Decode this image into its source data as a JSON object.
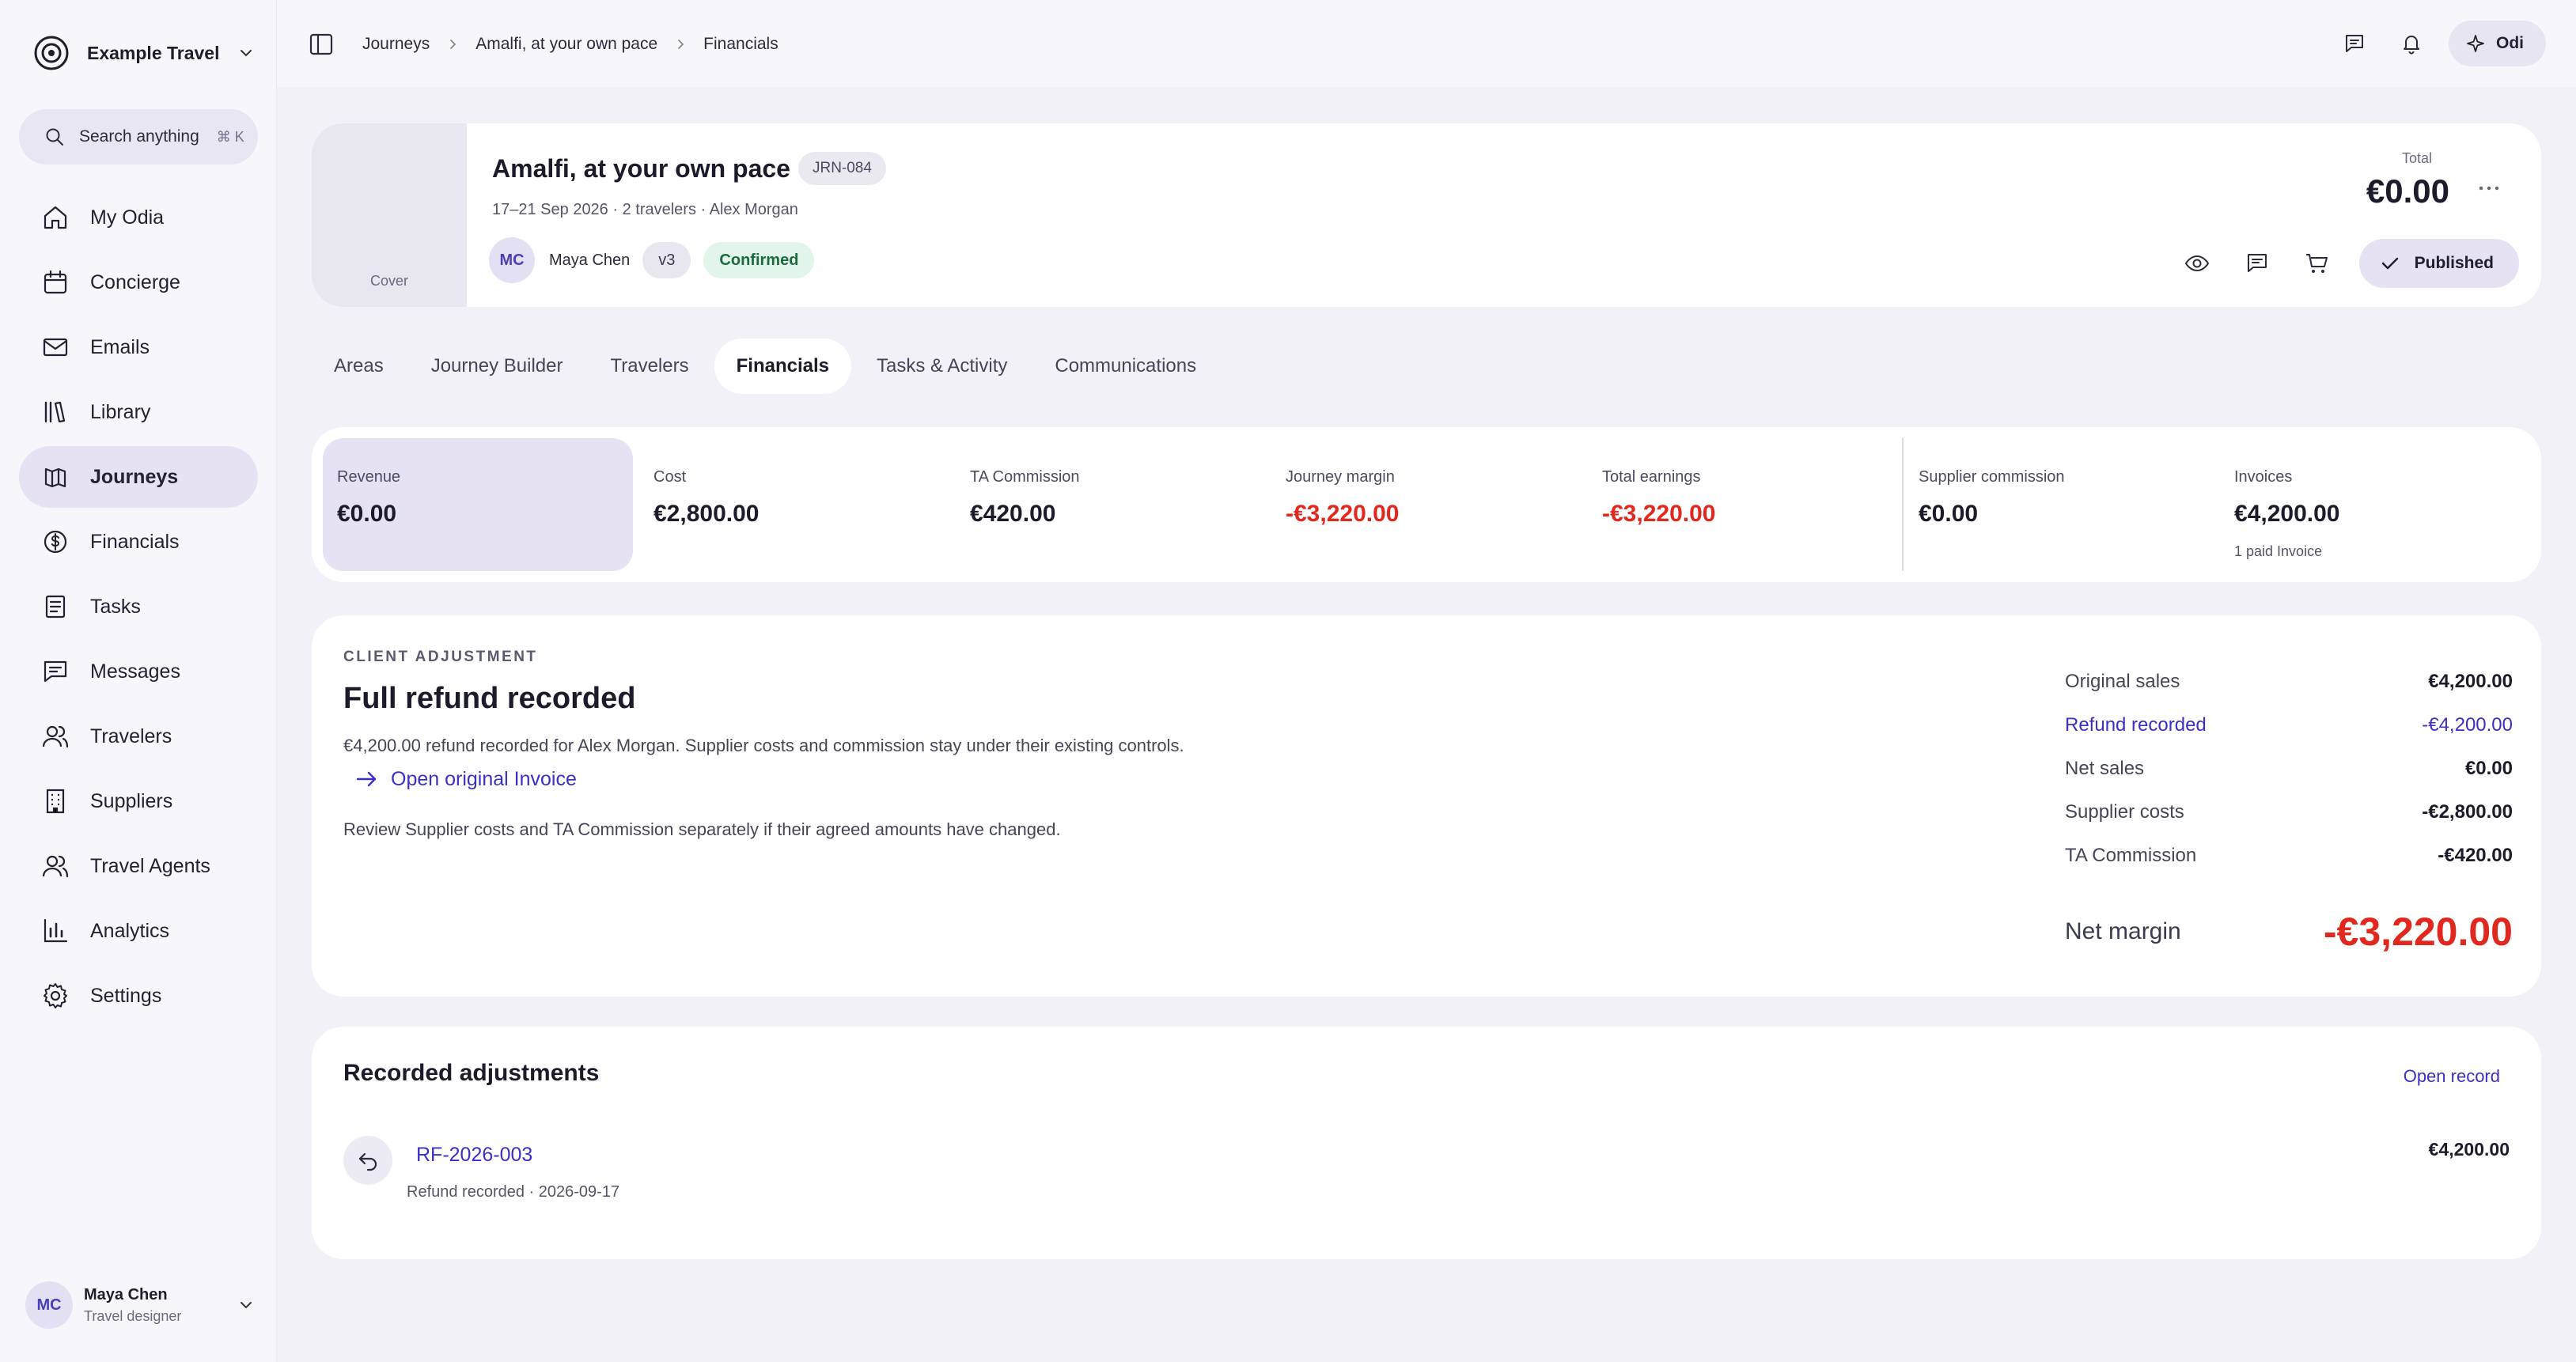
{
  "brand": {
    "name": "Example Travel"
  },
  "search": {
    "label": "Search anything",
    "shortcut": "⌘ K"
  },
  "nav": [
    {
      "label": "My Odia",
      "icon": "home-icon"
    },
    {
      "label": "Concierge",
      "icon": "calendar-icon"
    },
    {
      "label": "Emails",
      "icon": "mail-icon"
    },
    {
      "label": "Library",
      "icon": "library-icon"
    },
    {
      "label": "Journeys",
      "icon": "journeys-icon",
      "active": true
    },
    {
      "label": "Financials",
      "icon": "dollar-icon"
    },
    {
      "label": "Tasks",
      "icon": "tasks-icon"
    },
    {
      "label": "Messages",
      "icon": "message-icon"
    },
    {
      "label": "Travelers",
      "icon": "users-icon"
    },
    {
      "label": "Suppliers",
      "icon": "building-icon"
    },
    {
      "label": "Travel Agents",
      "icon": "agents-icon"
    },
    {
      "label": "Analytics",
      "icon": "chart-icon"
    },
    {
      "label": "Settings",
      "icon": "gear-icon"
    }
  ],
  "user": {
    "initials": "MC",
    "name": "Maya Chen",
    "role": "Travel designer"
  },
  "breadcrumbs": [
    "Journeys",
    "Amalfi, at your own pace",
    "Financials"
  ],
  "topbar": {
    "assistant_label": "Odi"
  },
  "journey": {
    "cover_label": "Cover",
    "title": "Amalfi, at your own pace",
    "code": "JRN-084",
    "meta": "17–21 Sep 2026 · 2 travelers · Alex Morgan",
    "owner_initials": "MC",
    "owner_name": "Maya Chen",
    "version": "v3",
    "status": "Confirmed",
    "total_label": "Total",
    "total_value": "€0.00",
    "published_label": "Published"
  },
  "tabs": [
    "Areas",
    "Journey Builder",
    "Travelers",
    "Financials",
    "Tasks & Activity",
    "Communications"
  ],
  "active_tab": "Financials",
  "metrics": [
    {
      "label": "Revenue",
      "value": "€0.00",
      "active": true
    },
    {
      "label": "Cost",
      "value": "€2,800.00"
    },
    {
      "label": "TA Commission",
      "value": "€420.00"
    },
    {
      "label": "Journey margin",
      "value": "-€3,220.00",
      "negative": true
    },
    {
      "label": "Total earnings",
      "value": "-€3,220.00",
      "negative": true
    },
    {
      "label": "Supplier commission",
      "value": "€0.00"
    },
    {
      "label": "Invoices",
      "value": "€4,200.00",
      "sub": "1 paid Invoice"
    }
  ],
  "adjustment": {
    "eyebrow": "CLIENT ADJUSTMENT",
    "title": "Full refund recorded",
    "description": "€4,200.00 refund recorded for Alex Morgan. Supplier costs and commission stay under their existing controls.",
    "link_label": "Open original Invoice",
    "note": "Review Supplier costs and TA Commission separately if their agreed amounts have changed.",
    "summary": [
      {
        "label": "Original sales",
        "value": "€4,200.00"
      },
      {
        "label": "Refund recorded",
        "value": "-€4,200.00",
        "accent": true
      },
      {
        "label": "Net sales",
        "value": "€0.00"
      },
      {
        "label": "Supplier costs",
        "value": "-€2,800.00"
      },
      {
        "label": "TA Commission",
        "value": "-€420.00"
      }
    ],
    "net_label": "Net margin",
    "net_value": "-€3,220.00"
  },
  "recorded": {
    "title": "Recorded adjustments",
    "open_label": "Open record",
    "items": [
      {
        "id": "RF-2026-003",
        "meta": "Refund recorded · 2026-09-17",
        "amount": "€4,200.00"
      }
    ]
  },
  "colors": {
    "accent": "#3b2fc9",
    "negative": "#e0281f",
    "active_bg": "#e6e2f3",
    "success": "#1c6b3c"
  }
}
